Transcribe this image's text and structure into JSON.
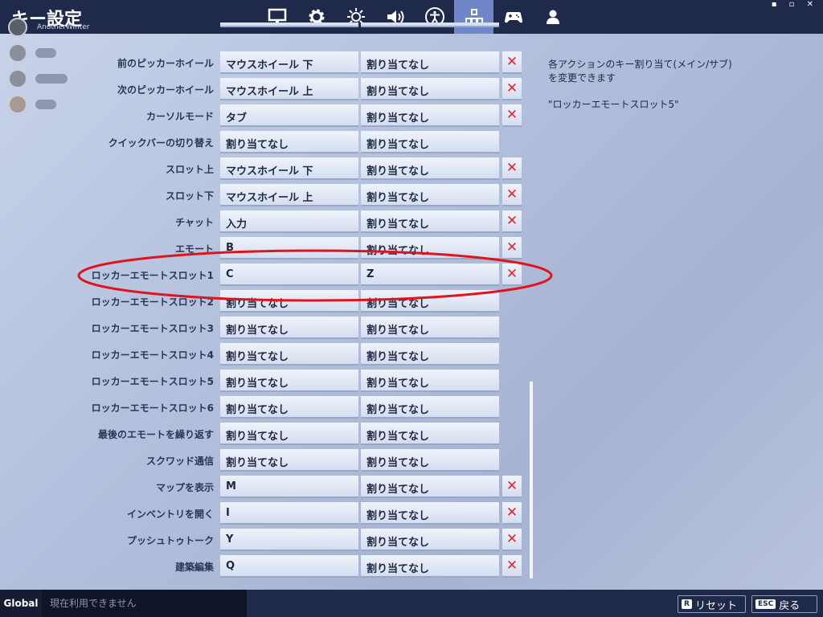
{
  "header": {
    "title": "キー設定",
    "window_controls": "▪ ▫ ✕",
    "tabs": [
      {
        "icon": "monitor-icon",
        "active": false
      },
      {
        "icon": "gear-icon",
        "active": false
      },
      {
        "icon": "brightness-icon",
        "active": false
      },
      {
        "icon": "speaker-icon",
        "active": false
      },
      {
        "icon": "accessibility-icon",
        "active": false
      },
      {
        "icon": "controls-icon",
        "active": true
      },
      {
        "icon": "gamepad-icon",
        "active": false
      },
      {
        "icon": "account-icon",
        "active": false
      }
    ]
  },
  "friends": {
    "player_name": "AnotherWinter"
  },
  "bindings": [
    {
      "label": "前のピッカーホイール",
      "primary": "マウスホイール 下",
      "secondary": "割り当てなし",
      "clear": true
    },
    {
      "label": "次のピッカーホイール",
      "primary": "マウスホイール 上",
      "secondary": "割り当てなし",
      "clear": true
    },
    {
      "label": "カーソルモード",
      "primary": "タブ",
      "secondary": "割り当てなし",
      "clear": true
    },
    {
      "label": "クイックバーの切り替え",
      "primary": "割り当てなし",
      "secondary": "割り当てなし",
      "clear": false
    },
    {
      "label": "スロット上",
      "primary": "マウスホイール 下",
      "secondary": "割り当てなし",
      "clear": true
    },
    {
      "label": "スロット下",
      "primary": "マウスホイール 上",
      "secondary": "割り当てなし",
      "clear": true
    },
    {
      "label": "チャット",
      "primary": "入力",
      "secondary": "割り当てなし",
      "clear": true
    },
    {
      "label": "エモート",
      "primary": "B",
      "secondary": "割り当てなし",
      "clear": true
    },
    {
      "label": "ロッカーエモートスロット1",
      "primary": "C",
      "secondary": "Z",
      "clear": true
    },
    {
      "label": "ロッカーエモートスロット2",
      "primary": "割り当てなし",
      "secondary": "割り当てなし",
      "clear": false
    },
    {
      "label": "ロッカーエモートスロット3",
      "primary": "割り当てなし",
      "secondary": "割り当てなし",
      "clear": false
    },
    {
      "label": "ロッカーエモートスロット4",
      "primary": "割り当てなし",
      "secondary": "割り当てなし",
      "clear": false
    },
    {
      "label": "ロッカーエモートスロット5",
      "primary": "割り当てなし",
      "secondary": "割り当てなし",
      "clear": false
    },
    {
      "label": "ロッカーエモートスロット6",
      "primary": "割り当てなし",
      "secondary": "割り当てなし",
      "clear": false
    },
    {
      "label": "最後のエモートを繰り返す",
      "primary": "割り当てなし",
      "secondary": "割り当てなし",
      "clear": false
    },
    {
      "label": "スクワッド通信",
      "primary": "割り当てなし",
      "secondary": "割り当てなし",
      "clear": false
    },
    {
      "label": "マップを表示",
      "primary": "M",
      "secondary": "割り当てなし",
      "clear": true
    },
    {
      "label": "インベントリを開く",
      "primary": "I",
      "secondary": "割り当てなし",
      "clear": true
    },
    {
      "label": "プッシュトゥトーク",
      "primary": "Y",
      "secondary": "割り当てなし",
      "clear": true
    },
    {
      "label": "建築編集",
      "primary": "Q",
      "secondary": "割り当てなし",
      "clear": true
    }
  ],
  "clear_symbol": "✕",
  "description": {
    "line1": "各アクションのキー割り当て(メイン/サブ)",
    "line2": "を変更できます",
    "selected": "\"ロッカーエモートスロット5\""
  },
  "footer": {
    "channel": "Global",
    "status": "現在利用できません",
    "reset_key": "R",
    "reset_label": "リセット",
    "back_key": "ESC",
    "back_label": "戻る"
  },
  "colors": {
    "topbar": "#1f2a4a",
    "active_tab": "#6f86c9",
    "clear": "#e0262e",
    "highlight": "#e0141e"
  }
}
